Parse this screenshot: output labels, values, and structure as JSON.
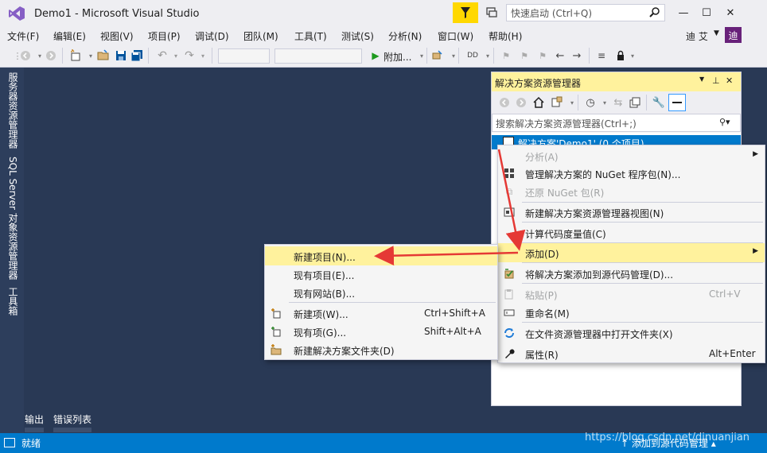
{
  "window": {
    "title": "Demo1 - Microsoft Visual Studio",
    "quick_launch_placeholder": "快速启动 (Ctrl+Q)",
    "minimize": "—",
    "maximize": "☐",
    "close": "✕"
  },
  "menubar": {
    "items": [
      "文件(F)",
      "编辑(E)",
      "视图(V)",
      "项目(P)",
      "调试(D)",
      "团队(M)",
      "工具(T)",
      "测试(S)",
      "分析(N)",
      "窗口(W)",
      "帮助(H)"
    ],
    "user_name": "迪 艾",
    "avatar_initial": "迪"
  },
  "toolbar": {
    "attach_label": "附加..."
  },
  "left_tabs": [
    "服务器资源管理器",
    "SQL Server 对象资源管理器",
    "工具箱"
  ],
  "bottom_tabs": [
    "输出",
    "错误列表"
  ],
  "status": {
    "text": "就绪",
    "source_control": "添加到源代码管理",
    "watermark": "https://blog.csdn.net/dinuanjian"
  },
  "solution_explorer": {
    "title": "解决方案资源管理器",
    "search_placeholder": "搜索解决方案资源管理器(Ctrl+;)",
    "root_item": "解决方案'Demo1' (0 个项目)"
  },
  "context_menu": {
    "items": [
      {
        "label": "分析(A)",
        "disabled": true,
        "submenu": true,
        "icon": ""
      },
      {
        "label": "管理解决方案的 NuGet 程序包(N)...",
        "icon": "nuget-icon"
      },
      {
        "label": "还原 NuGet 包(R)",
        "disabled": true,
        "icon": "restore-icon"
      },
      {
        "label": "新建解决方案资源管理器视图(N)",
        "icon": "new-view-icon"
      },
      {
        "label": "计算代码度量值(C)",
        "icon": ""
      },
      {
        "label": "添加(D)",
        "highlighted": true,
        "submenu": true,
        "icon": ""
      },
      {
        "label": "将解决方案添加到源代码管理(D)...",
        "icon": "source-control-icon"
      },
      {
        "label": "粘贴(P)",
        "shortcut": "Ctrl+V",
        "disabled": true,
        "icon": "paste-icon"
      },
      {
        "label": "重命名(M)",
        "icon": "rename-icon"
      },
      {
        "label": "在文件资源管理器中打开文件夹(X)",
        "icon": "open-folder-icon"
      },
      {
        "label": "属性(R)",
        "shortcut": "Alt+Enter",
        "icon": "wrench-icon"
      }
    ]
  },
  "add_submenu": {
    "items": [
      {
        "label": "新建项目(N)...",
        "highlighted": true,
        "icon": ""
      },
      {
        "label": "现有项目(E)...",
        "icon": ""
      },
      {
        "label": "现有网站(B)...",
        "icon": ""
      },
      {
        "label": "新建项(W)...",
        "shortcut": "Ctrl+Shift+A",
        "icon": "new-item-icon"
      },
      {
        "label": "现有项(G)...",
        "shortcut": "Shift+Alt+A",
        "icon": "existing-item-icon"
      },
      {
        "label": "新建解决方案文件夹(D)",
        "icon": "new-folder-icon"
      }
    ]
  },
  "colors": {
    "accent": "#007acc",
    "highlight": "#fff29d",
    "avatar": "#68217a",
    "filter": "#ffd800",
    "arrow": "#e53935"
  }
}
